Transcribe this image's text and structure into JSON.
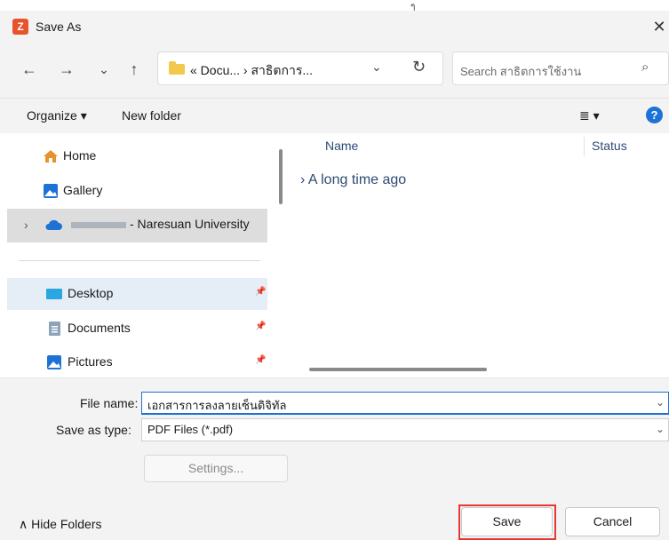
{
  "window": {
    "title": "Save As",
    "close_glyph": "✕",
    "app_icon_letter": "Z",
    "top_mark": "ๆ"
  },
  "nav": {
    "back": "←",
    "forward": "→",
    "recent": "⌄",
    "up": "↑",
    "address_text": "« Docu... › สาธิตการ...",
    "address_chevron": "⌄",
    "refresh": "↻",
    "search_placeholder": "Search สาธิตการใช้งาน",
    "search_icon": "⌕"
  },
  "toolbar": {
    "organize": "Organize ▾",
    "new_folder": "New folder",
    "view_glyph": "≣ ▾",
    "help": "?"
  },
  "sidebar": {
    "home": "Home",
    "gallery": "Gallery",
    "onedrive": "- Naresuan University",
    "expand_glyph": "›",
    "desktop": "Desktop",
    "documents": "Documents",
    "pictures": "Pictures",
    "pin_glyph": "📌"
  },
  "main": {
    "col_name": "Name",
    "col_status": "Status",
    "group_label": "›  A long time ago"
  },
  "form": {
    "file_name_label": "File name:",
    "file_name_value": "เอกสารการลงลายเซ็นดิจิทัล",
    "save_type_label": "Save as type:",
    "save_type_value": "PDF Files (*.pdf)",
    "dropdown_glyph": "⌄",
    "settings": "Settings...",
    "hide_folders": "∧  Hide Folders",
    "save": "Save",
    "cancel": "Cancel"
  },
  "colors": {
    "accent": "#1e72d6",
    "highlight": "#e53935",
    "chrome": "#f3f3f3",
    "selection": "#e5edf6"
  }
}
